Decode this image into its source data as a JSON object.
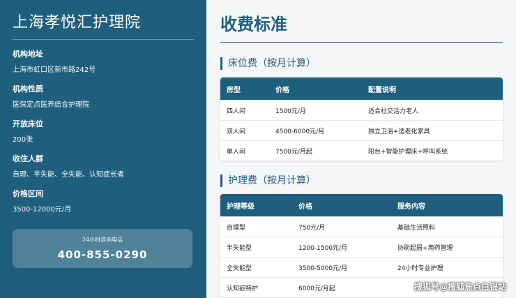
{
  "sidebar": {
    "title": "上海孝悦汇护理院",
    "items": [
      {
        "label": "机构地址",
        "value": "上海市虹口区新市路242号"
      },
      {
        "label": "机构性质",
        "value": "医保定点医养结合护理院"
      },
      {
        "label": "开放床位",
        "value": "200张"
      },
      {
        "label": "收住人群",
        "value": "自理、半失能、全失能、认知症长者"
      },
      {
        "label": "价格区间",
        "value": "3500-12000元/月"
      }
    ],
    "hotline": {
      "label": "24小时咨询电话",
      "number": "400-855-0290"
    }
  },
  "main": {
    "title": "收费标准",
    "bed_section": {
      "heading": "床位费（按月计算）",
      "headers": [
        "房型",
        "价格",
        "配置说明"
      ],
      "rows": [
        [
          "四人间",
          "1500元/月",
          "适合社交活力老人"
        ],
        [
          "双人间",
          "4500-6000元/月",
          "独立卫浴+适老化家具"
        ],
        [
          "单人间",
          "7500元/月起",
          "阳台+智能护理床+呼叫系统"
        ]
      ]
    },
    "care_section": {
      "heading": "护理费（按月计算）",
      "headers": [
        "护理等级",
        "价格",
        "服务内容"
      ],
      "rows": [
        [
          "自理型",
          "750元/月",
          "基础生活照料"
        ],
        [
          "半失能型",
          "1200-1500元/月",
          "协助起居+用药管理"
        ],
        [
          "全失能型",
          "3500-5000元/月",
          "24小时专业护理"
        ],
        [
          "认知症特护",
          "6000元/月起",
          ""
        ]
      ]
    }
  },
  "watermark": "搜狐号@搜狐焦点白银站",
  "colors": {
    "primary": "#1f5f7e",
    "background": "#f4f6f8"
  }
}
